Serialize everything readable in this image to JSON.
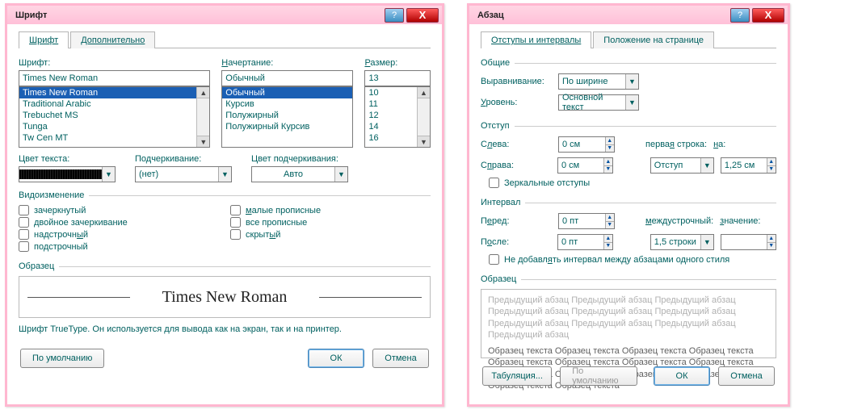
{
  "font_dialog": {
    "title": "Шрифт",
    "tabs": {
      "font": "Шрифт",
      "advanced": "Дополнительно"
    },
    "labels": {
      "font": "Шрифт:",
      "style": "Начертание:",
      "size": "Размер:",
      "text_color": "Цвет текста:",
      "underline": "Подчеркивание:",
      "underline_color": "Цвет подчеркивания:"
    },
    "font_value": "Times New Roman",
    "font_list": [
      "Times New Roman",
      "Traditional Arabic",
      "Trebuchet MS",
      "Tunga",
      "Tw Cen MT"
    ],
    "style_value": "Обычный",
    "style_list": [
      "Обычный",
      "Курсив",
      "Полужирный",
      "Полужирный Курсив"
    ],
    "size_value": "13",
    "size_list": [
      "10",
      "11",
      "12",
      "14",
      "16"
    ],
    "underline_none": "(нет)",
    "auto": "Авто",
    "effects_title": "Видоизменение",
    "effects_left": [
      "зачеркнутый",
      "двойное зачеркивание",
      "надстрочный",
      "подстрочный"
    ],
    "effects_right": [
      "малые прописные",
      "все прописные",
      "скрытый"
    ],
    "sample_title": "Образец",
    "sample_text": "Times New Roman",
    "info": "Шрифт TrueType. Он используется для вывода как на экран, так и на принтер.",
    "buttons": {
      "default": "По умолчанию",
      "ok": "ОК",
      "cancel": "Отмена"
    }
  },
  "para_dialog": {
    "title": "Абзац",
    "tabs": {
      "indent": "Отступы и интервалы",
      "position": "Положение на странице"
    },
    "groups": {
      "common": "Общие",
      "indent": "Отступ",
      "interval": "Интервал",
      "sample": "Образец"
    },
    "labels": {
      "align": "Выравнивание:",
      "level": "Уровень:",
      "left": "Слева:",
      "right": "Справа:",
      "firstline": "первая строка:",
      "by": "на:",
      "mirror": "Зеркальные отступы",
      "before": "Перед:",
      "after": "После:",
      "linespacing": "междустрочный:",
      "value": "значение:",
      "nospace": "Не добавлять интервал между абзацами одного стиля"
    },
    "values": {
      "align": "По ширине",
      "level": "Основной текст",
      "left": "0 см",
      "right": "0 см",
      "firstline_type": "Отступ",
      "firstline_by": "1,25 см",
      "before": "0 пт",
      "after": "0 пт",
      "linespacing": "1,5 строки",
      "linespacing_value": ""
    },
    "sample_grey": "Предыдущий абзац Предыдущий абзац Предыдущий абзац Предыдущий абзац Предыдущий абзац Предыдущий абзац Предыдущий абзац Предыдущий абзац Предыдущий абзац Предыдущий абзац",
    "sample_dark": "Образец текста Образец текста Образец текста Образец текста Образец текста Образец текста Образец текста Образец текста Образец текста Образец текста Образец текста Образец текста Образец текста Образец текста",
    "buttons": {
      "tabs": "Табуляция...",
      "default": "По умолчанию",
      "ok": "ОК",
      "cancel": "Отмена"
    }
  }
}
